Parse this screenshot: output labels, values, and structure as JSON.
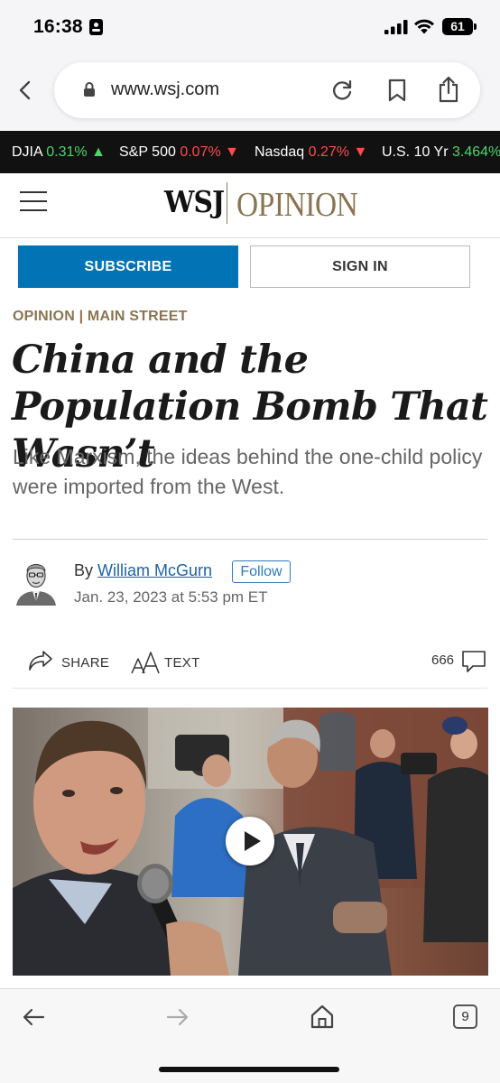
{
  "status_bar": {
    "time": "16:38",
    "battery": "61",
    "icons": [
      "id-badge-icon",
      "signal-icon",
      "wifi-icon",
      "battery-icon"
    ]
  },
  "browser": {
    "url": "www.wsj.com",
    "tab_count": "9",
    "icons": [
      "back-chevron-icon",
      "lock-icon",
      "reload-icon",
      "bookmark-icon",
      "share-icon",
      "nav-back-icon",
      "nav-forward-icon",
      "home-icon"
    ]
  },
  "ticker": [
    {
      "name": "DJIA",
      "change": "0.31%",
      "arrow": "▲",
      "direction": "up"
    },
    {
      "name": "S&P 500",
      "change": "0.07%",
      "arrow": "▼",
      "direction": "down"
    },
    {
      "name": "Nasdaq",
      "change": "0.27%",
      "arrow": "▼",
      "direction": "down"
    },
    {
      "name": "U.S. 10 Yr",
      "change": "3.464%",
      "arrow": "▲",
      "direction": "up"
    }
  ],
  "header": {
    "logo": "WSJ",
    "section": "OPINION"
  },
  "auth": {
    "subscribe_label": "SUBSCRIBE",
    "signin_label": "SIGN IN"
  },
  "article": {
    "kicker": "OPINION | MAIN STREET",
    "headline": "China and the Population Bomb That Wasn’t",
    "dek": "Like Marxism, the ideas behind the one-child policy were imported from the West.",
    "byline_prefix": "By",
    "author": "William McGurn",
    "follow_label": "Follow",
    "timestamp": "Jan. 23, 2023 at 5:53 pm ET"
  },
  "toolbar": {
    "share_label": "SHARE",
    "text_label": "TEXT",
    "comment_count": "666"
  },
  "colors": {
    "subscribe_blue": "#0274b6",
    "opinion_gold": "#8b7550",
    "ticker_up": "#4bd66a",
    "ticker_down": "#ff4b4b",
    "link_blue": "#1a63a8"
  }
}
